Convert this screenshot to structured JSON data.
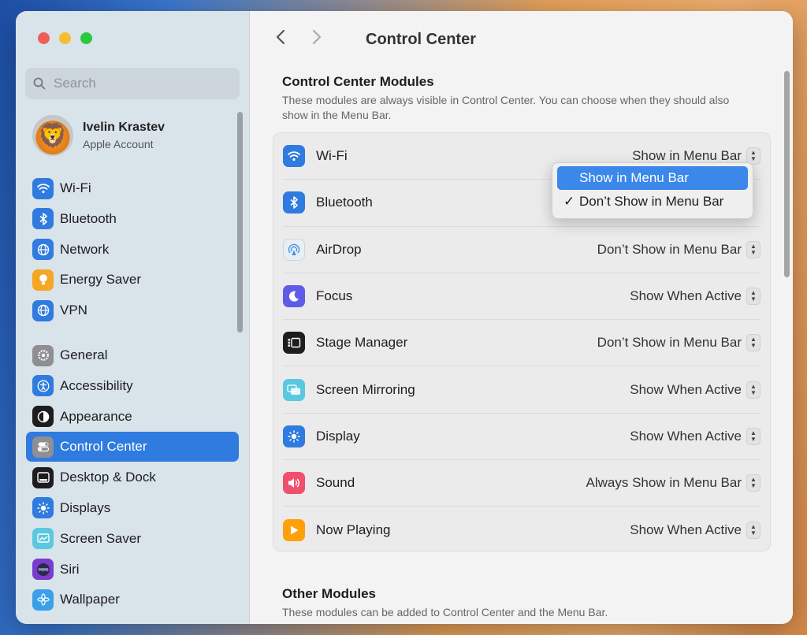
{
  "window": {
    "title": "Control Center"
  },
  "search": {
    "placeholder": "Search"
  },
  "account": {
    "name": "Ivelin Krastev",
    "subtitle": "Apple Account"
  },
  "sidebar": {
    "group1": [
      {
        "label": "Wi-Fi",
        "icon": "wifi-icon",
        "color": "#2f7bdf"
      },
      {
        "label": "Bluetooth",
        "icon": "bluetooth-icon",
        "color": "#2f7bdf"
      },
      {
        "label": "Network",
        "icon": "globe-icon",
        "color": "#2f7bdf"
      },
      {
        "label": "Energy Saver",
        "icon": "lightbulb-icon",
        "color": "#f5a623"
      },
      {
        "label": "VPN",
        "icon": "globe-icon",
        "color": "#2f7bdf"
      }
    ],
    "group2": [
      {
        "label": "General",
        "icon": "gear-icon",
        "color": "#8e8e93"
      },
      {
        "label": "Accessibility",
        "icon": "accessibility-icon",
        "color": "#2f7bdf"
      },
      {
        "label": "Appearance",
        "icon": "appearance-icon",
        "color": "#1d1d1f"
      },
      {
        "label": "Control Center",
        "icon": "toggles-icon",
        "color": "#8e8e93",
        "active": true
      },
      {
        "label": "Desktop & Dock",
        "icon": "dock-icon",
        "color": "#1d1d1f"
      },
      {
        "label": "Displays",
        "icon": "sun-icon",
        "color": "#2f7bdf"
      },
      {
        "label": "Screen Saver",
        "icon": "screensaver-icon",
        "color": "#5ac8e0"
      },
      {
        "label": "Siri",
        "icon": "siri-icon",
        "color": "#7a3bd0"
      },
      {
        "label": "Wallpaper",
        "icon": "flower-icon",
        "color": "#3aa0e8"
      }
    ]
  },
  "section1": {
    "title": "Control Center Modules",
    "desc": "These modules are always visible in Control Center. You can choose when they should also show in the Menu Bar."
  },
  "modules": [
    {
      "label": "Wi-Fi",
      "value": "Show in Menu Bar",
      "icon": "wifi-icon",
      "color": "#2f7bdf"
    },
    {
      "label": "Bluetooth",
      "value": "",
      "icon": "bluetooth-icon",
      "color": "#2f7bdf"
    },
    {
      "label": "AirDrop",
      "value": "Don’t Show in Menu Bar",
      "icon": "airdrop-icon",
      "color": "#e9eef2"
    },
    {
      "label": "Focus",
      "value": "Show When Active",
      "icon": "moon-icon",
      "color": "#5e5ce6"
    },
    {
      "label": "Stage Manager",
      "value": "Don’t Show in Menu Bar",
      "icon": "stage-manager-icon",
      "color": "#1d1d1f"
    },
    {
      "label": "Screen Mirroring",
      "value": "Show When Active",
      "icon": "screen-mirroring-icon",
      "color": "#5ac8e0"
    },
    {
      "label": "Display",
      "value": "Show When Active",
      "icon": "sun-icon",
      "color": "#2f7bdf"
    },
    {
      "label": "Sound",
      "value": "Always Show in Menu Bar",
      "icon": "speaker-icon",
      "color": "#f0506e"
    },
    {
      "label": "Now Playing",
      "value": "Show When Active",
      "icon": "play-icon",
      "color": "#ff9f0a"
    }
  ],
  "popup": {
    "options": [
      "Show in Menu Bar",
      "Don’t Show in Menu Bar"
    ],
    "highlighted": "Show in Menu Bar",
    "checked": "Don’t Show in Menu Bar"
  },
  "section2": {
    "title": "Other Modules",
    "desc": "These modules can be added to Control Center and the Menu Bar."
  }
}
